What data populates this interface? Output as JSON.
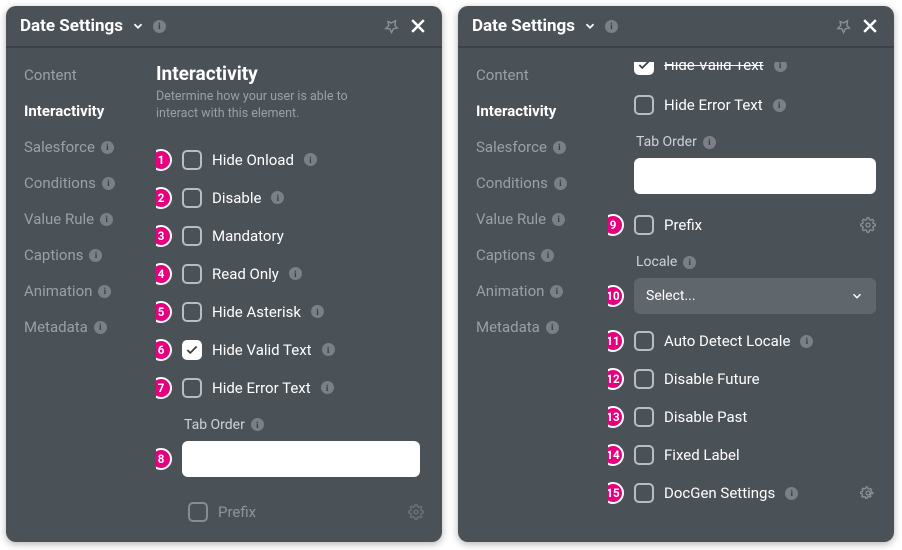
{
  "header": {
    "title": "Date Settings"
  },
  "sidebar": {
    "items": [
      {
        "label": "Content",
        "info": false
      },
      {
        "label": "Interactivity",
        "info": false
      },
      {
        "label": "Salesforce",
        "info": true
      },
      {
        "label": "Conditions",
        "info": true
      },
      {
        "label": "Value Rule",
        "info": true
      },
      {
        "label": "Captions",
        "info": true
      },
      {
        "label": "Animation",
        "info": true
      },
      {
        "label": "Metadata",
        "info": true
      }
    ],
    "activeIndex": 1
  },
  "section": {
    "title": "Interactivity",
    "desc": "Determine how your user is able to interact with this element."
  },
  "panel1_rows": [
    {
      "marker": "1",
      "label": "Hide Onload",
      "checked": false,
      "info": true
    },
    {
      "marker": "2",
      "label": "Disable",
      "checked": false,
      "info": true
    },
    {
      "marker": "3",
      "label": "Mandatory",
      "checked": false,
      "info": false
    },
    {
      "marker": "4",
      "label": "Read Only",
      "checked": false,
      "info": true
    },
    {
      "marker": "5",
      "label": "Hide Asterisk",
      "checked": false,
      "info": true
    },
    {
      "marker": "6",
      "label": "Hide Valid Text",
      "checked": true,
      "info": true
    },
    {
      "marker": "7",
      "label": "Hide Error Text",
      "checked": false,
      "info": true
    }
  ],
  "panel1_tab_order": {
    "marker": "8",
    "label": "Tab Order",
    "value": ""
  },
  "panel1_peek": {
    "label": "Prefix"
  },
  "panel2_clip": {
    "label": "Hide Valid Text"
  },
  "panel2_error_row": {
    "label": "Hide Error Text"
  },
  "panel2_tab_order": {
    "label": "Tab Order",
    "value": ""
  },
  "panel2_prefix": {
    "marker": "9",
    "label": "Prefix"
  },
  "panel2_locale": {
    "marker": "10",
    "label": "Locale",
    "placeholder": "Select..."
  },
  "panel2_rows": [
    {
      "marker": "11",
      "label": "Auto Detect Locale",
      "checked": false,
      "info": true
    },
    {
      "marker": "12",
      "label": "Disable Future",
      "checked": false,
      "info": false
    },
    {
      "marker": "13",
      "label": "Disable Past",
      "checked": false,
      "info": false
    },
    {
      "marker": "14",
      "label": "Fixed Label",
      "checked": false,
      "info": false
    },
    {
      "marker": "15",
      "label": "DocGen Settings",
      "checked": false,
      "info": true,
      "gear": true
    }
  ]
}
